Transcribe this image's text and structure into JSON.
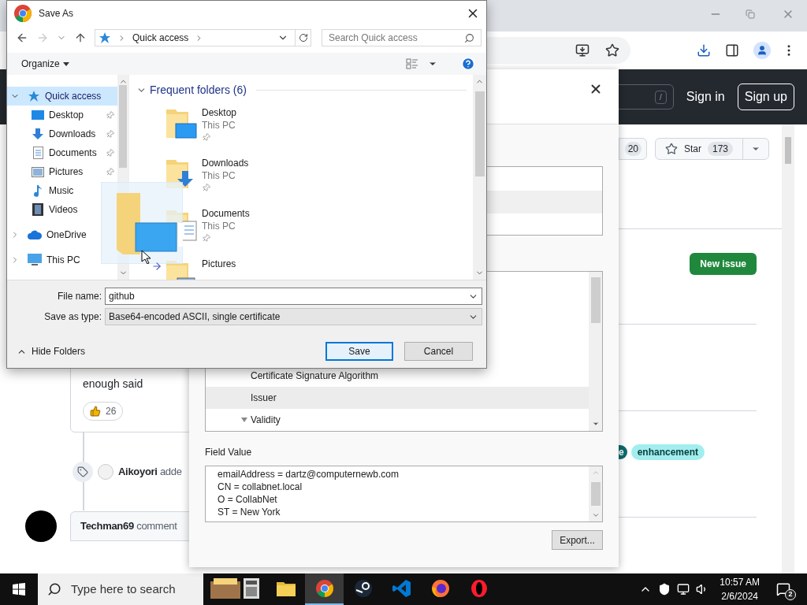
{
  "github": {
    "search_key": "/",
    "sign_in": "Sign in",
    "sign_up": "Sign up",
    "watch_count": "20",
    "star_label": "Star",
    "star_count": "173",
    "new_issue": "New issue",
    "comment": {
      "body": "enough said",
      "reaction_count": "26"
    },
    "event": {
      "author": "Aikoyori",
      "action": "adde"
    },
    "next_comment": {
      "author": "Techman69",
      "action": "comment"
    },
    "labels": [
      {
        "text": "e",
        "color": "#0e6b6b"
      },
      {
        "text": "enhancement",
        "color": "#a2eeef"
      }
    ]
  },
  "certificate_dialog": {
    "fields": [
      {
        "name": "Certificate Signature Algorithm",
        "kind": "leaf",
        "selected": false
      },
      {
        "name": "Issuer",
        "kind": "leaf",
        "selected": true
      },
      {
        "name": "Validity",
        "kind": "group",
        "expanded": true,
        "selected": false
      }
    ],
    "field_value_label": "Field Value",
    "field_value_lines": [
      "emailAddress = dartz@computernewb.com",
      "CN = collabnet.local",
      "O = CollabNet",
      "ST = New York"
    ],
    "export": "Export..."
  },
  "save_as": {
    "title": "Save As",
    "breadcrumb": "Quick access",
    "search_placeholder": "Search Quick access",
    "organize": "Organize",
    "nav": [
      {
        "label": "Quick access",
        "kind": "star",
        "selected": true,
        "expanded": true,
        "children": [
          {
            "label": "Desktop",
            "kind": "desktop",
            "pinned": true
          },
          {
            "label": "Downloads",
            "kind": "downloads",
            "pinned": true
          },
          {
            "label": "Documents",
            "kind": "documents",
            "pinned": true
          },
          {
            "label": "Pictures",
            "kind": "pictures",
            "pinned": true
          },
          {
            "label": "Music",
            "kind": "music",
            "pinned": false
          },
          {
            "label": "Videos",
            "kind": "videos",
            "pinned": false
          }
        ]
      },
      {
        "label": "OneDrive",
        "kind": "cloud",
        "selected": false,
        "expanded": false
      },
      {
        "label": "This PC",
        "kind": "pc",
        "selected": false,
        "expanded": false
      }
    ],
    "section": "Frequent folders (6)",
    "folders": [
      {
        "name": "Desktop",
        "kind": "desktop",
        "location": "This PC",
        "pinned": true
      },
      {
        "name": "Downloads",
        "kind": "downloads",
        "location": "This PC",
        "pinned": true
      },
      {
        "name": "Documents",
        "kind": "documents",
        "location": "This PC",
        "pinned": true
      },
      {
        "name": "Pictures",
        "kind": "pictures",
        "pinned": false
      }
    ],
    "file_name_label": "File name:",
    "file_name": "github",
    "save_type_label": "Save as type:",
    "save_type": "Base64-encoded ASCII, single certificate",
    "hide_folders": "Hide Folders",
    "save": "Save",
    "cancel": "Cancel"
  },
  "taskbar": {
    "search_placeholder": "Type here to search",
    "apps": [
      {
        "kind": "cabinet",
        "active": false
      },
      {
        "kind": "folder",
        "active": false
      },
      {
        "kind": "chrome",
        "active": true
      },
      {
        "kind": "steam",
        "active": false
      },
      {
        "kind": "vscode",
        "active": false
      },
      {
        "kind": "firefox",
        "active": false
      },
      {
        "kind": "opera",
        "active": false
      }
    ],
    "time": "10:57 AM",
    "date": "2/6/2024",
    "notifications": "2"
  }
}
